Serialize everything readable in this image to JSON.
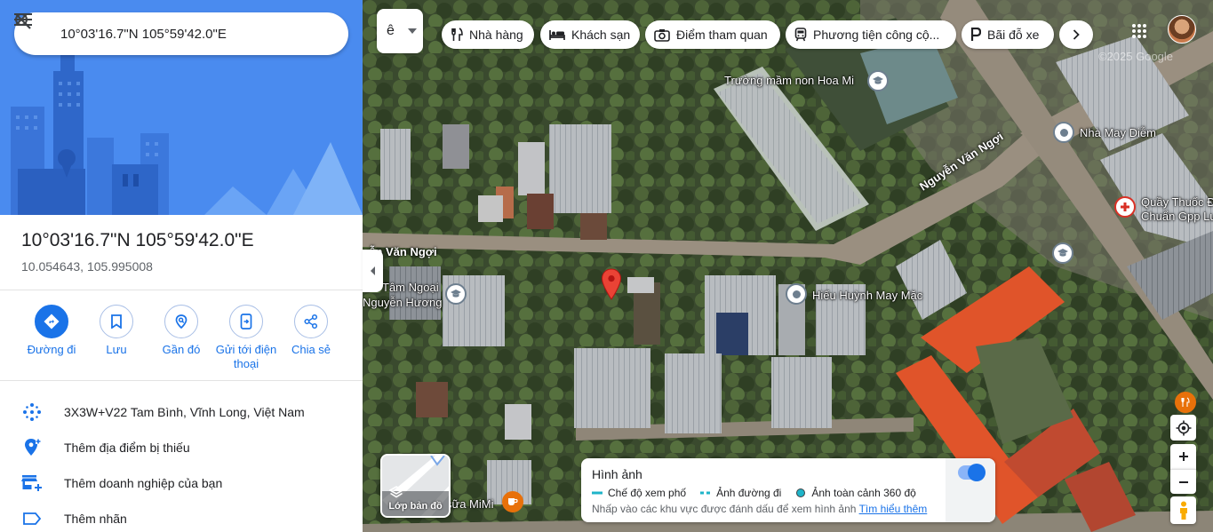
{
  "search": {
    "value": "10°03'16.7\"N 105°59'42.0\"E"
  },
  "place": {
    "title": "10°03'16.7\"N 105°59'42.0\"E",
    "coords": "10.054643, 105.995008"
  },
  "actions": [
    {
      "label": "Đường đi",
      "icon": "directions-icon"
    },
    {
      "label": "Lưu",
      "icon": "bookmark-icon"
    },
    {
      "label": "Gần đó",
      "icon": "nearby-icon"
    },
    {
      "label": "Gửi tới điện thoại",
      "icon": "send-to-phone-icon"
    },
    {
      "label": "Chia sẻ",
      "icon": "share-icon"
    }
  ],
  "info_rows": [
    {
      "text": "3X3W+V22 Tam Bình, Vĩnh Long, Việt Nam",
      "icon": "plus-code-icon"
    },
    {
      "text": "Thêm địa điểm bị thiếu",
      "icon": "add-place-icon"
    },
    {
      "text": "Thêm doanh nghiệp của bạn",
      "icon": "add-business-icon"
    },
    {
      "text": "Thêm nhãn",
      "icon": "label-icon"
    }
  ],
  "map": {
    "lang_select": "ê",
    "chips": [
      {
        "label": "Nhà hàng",
        "icon": "restaurant-icon"
      },
      {
        "label": "Khách sạn",
        "icon": "hotel-icon"
      },
      {
        "label": "Điểm tham quan",
        "icon": "camera-icon"
      },
      {
        "label": "Phương tiện công cộ...",
        "icon": "transit-icon"
      },
      {
        "label": "Bãi đỗ xe",
        "icon": "parking-icon"
      }
    ],
    "copyright": "©2025 Google",
    "labels": {
      "school": "Trường mầm non Hoa Mi",
      "store1": "Nhà May Diễm",
      "pharmacy_line1": "Quầy Thuốc Đ",
      "pharmacy_line2": "Chuẩn Gpp Lu",
      "road1": "Nguyễn Văn Ngợi",
      "road2": "yễn Văn Ngợi",
      "tam_line1": "Tâm Ngoại",
      "tam_line2": "Nguyễn Hương",
      "tailor": "Hiếu Huỳnh May Mặc",
      "milk": "sữa MiMi"
    },
    "layers_label": "Lớp bản đồ",
    "imagery": {
      "title": "Hình ảnh",
      "legend": [
        {
          "label": "Chế độ xem phố",
          "color": "#1fb4c9",
          "style": "solid"
        },
        {
          "label": "Ảnh đường đi",
          "color": "#1fb4c9",
          "style": "dashed"
        },
        {
          "label": "Ảnh toàn cảnh 360 độ",
          "color": "#1fb4c9",
          "style": "dot"
        }
      ],
      "hint": "Nhấp vào các khu vực được đánh dấu để xem hình ảnh",
      "learn_more": "Tìm hiểu thêm",
      "toggle_on": true
    }
  },
  "colors": {
    "accent": "#1a73e8",
    "pin": "#ea4335",
    "roof_orange": "#e0542a"
  }
}
